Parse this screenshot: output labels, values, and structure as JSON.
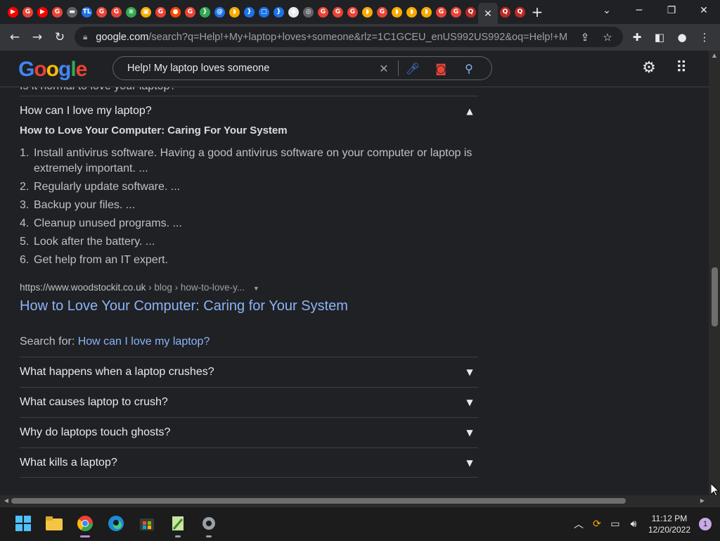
{
  "browser": {
    "tabs": [
      {
        "icon": "youtube-icon",
        "color": "#ff0000",
        "glyph": "▶"
      },
      {
        "icon": "google-icon",
        "color": "#ea4335",
        "glyph": "G"
      },
      {
        "icon": "youtube-icon",
        "color": "#ff0000",
        "glyph": "▶"
      },
      {
        "icon": "google-icon",
        "color": "#ea4335",
        "glyph": "G"
      },
      {
        "icon": "monitor-icon",
        "color": "#5f6368",
        "glyph": "▬"
      },
      {
        "icon": "tl-icon",
        "color": "#1a73e8",
        "glyph": "TL"
      },
      {
        "icon": "google-icon",
        "color": "#ea4335",
        "glyph": "G"
      },
      {
        "icon": "google-icon",
        "color": "#ea4335",
        "glyph": "G"
      },
      {
        "icon": "wifi-icon",
        "color": "#34a853",
        "glyph": "≋"
      },
      {
        "icon": "bag-icon",
        "color": "#f9ab00",
        "glyph": "▣"
      },
      {
        "icon": "google-icon",
        "color": "#ea4335",
        "glyph": "G"
      },
      {
        "icon": "reddit-icon",
        "color": "#ff4500",
        "glyph": "●"
      },
      {
        "icon": "google-icon",
        "color": "#ea4335",
        "glyph": "G"
      },
      {
        "icon": "brace-icon",
        "color": "#34a853",
        "glyph": "}"
      },
      {
        "icon": "at-icon",
        "color": "#1a73e8",
        "glyph": "@"
      },
      {
        "icon": "shield-icon",
        "color": "#f9ab00",
        "glyph": "◗"
      },
      {
        "icon": "brace-icon",
        "color": "#1a73e8",
        "glyph": "}"
      },
      {
        "icon": "chat-icon",
        "color": "#1a73e8",
        "glyph": "▢"
      },
      {
        "icon": "brace-icon",
        "color": "#1a73e8",
        "glyph": "}"
      },
      {
        "icon": "ring-icon",
        "color": "#e8eaed",
        "glyph": "◆"
      },
      {
        "icon": "chrome-icon",
        "color": "#5f6368",
        "glyph": "◎"
      },
      {
        "icon": "google-icon",
        "color": "#ea4335",
        "glyph": "G"
      },
      {
        "icon": "google-icon",
        "color": "#ea4335",
        "glyph": "G"
      },
      {
        "icon": "google-icon",
        "color": "#ea4335",
        "glyph": "G"
      },
      {
        "icon": "shield-icon",
        "color": "#f9ab00",
        "glyph": "◗"
      },
      {
        "icon": "google-icon",
        "color": "#ea4335",
        "glyph": "G"
      },
      {
        "icon": "shield-icon",
        "color": "#f9ab00",
        "glyph": "◗"
      },
      {
        "icon": "shield-icon",
        "color": "#f9ab00",
        "glyph": "◗"
      },
      {
        "icon": "shield-icon",
        "color": "#f9ab00",
        "glyph": "◗"
      },
      {
        "icon": "google-icon",
        "color": "#ea4335",
        "glyph": "G"
      },
      {
        "icon": "google-icon",
        "color": "#ea4335",
        "glyph": "G"
      },
      {
        "icon": "quora-icon",
        "color": "#b92b27",
        "glyph": "Q"
      }
    ],
    "tabs_after": [
      {
        "icon": "quora-icon",
        "color": "#b92b27",
        "glyph": "Q"
      },
      {
        "icon": "quora-icon",
        "color": "#b92b27",
        "glyph": "Q"
      }
    ],
    "url_host": "google.com",
    "url_rest": "/search?q=Help!+My+laptop+loves+someone&rlz=1C1GCEU_enUS992US992&oq=Help!+My..."
  },
  "google": {
    "query": "Help! My laptop loves someone"
  },
  "results": {
    "partial_question": "Is it normal to love your laptop?",
    "open_question": "How can I love my laptop?",
    "answer_title": "How to Love Your Computer: Caring For Your System",
    "answer_items": [
      {
        "num": "1.",
        "text": "Install antivirus software. Having a good antivirus software on your computer or laptop is extremely important. ..."
      },
      {
        "num": "2.",
        "text": "Regularly update software. ..."
      },
      {
        "num": "3.",
        "text": "Backup your files. ..."
      },
      {
        "num": "4.",
        "text": "Cleanup unused programs. ..."
      },
      {
        "num": "5.",
        "text": "Look after the battery. ..."
      },
      {
        "num": "6.",
        "text": "Get help from an IT expert."
      }
    ],
    "source_domain": "https://www.woodstockit.co.uk",
    "source_path": " › blog › how-to-love-y...",
    "source_title": "How to Love Your Computer: Caring for Your System",
    "search_for_label": "Search for: ",
    "search_for_link": "How can I love my laptop?",
    "more_questions": [
      "What happens when a laptop crushes?",
      "What causes laptop to crush?",
      "Why do laptops touch ghosts?",
      "What kills a laptop?"
    ]
  },
  "taskbar": {
    "time": "11:12 PM",
    "date": "12/20/2022",
    "notifications": "1"
  }
}
